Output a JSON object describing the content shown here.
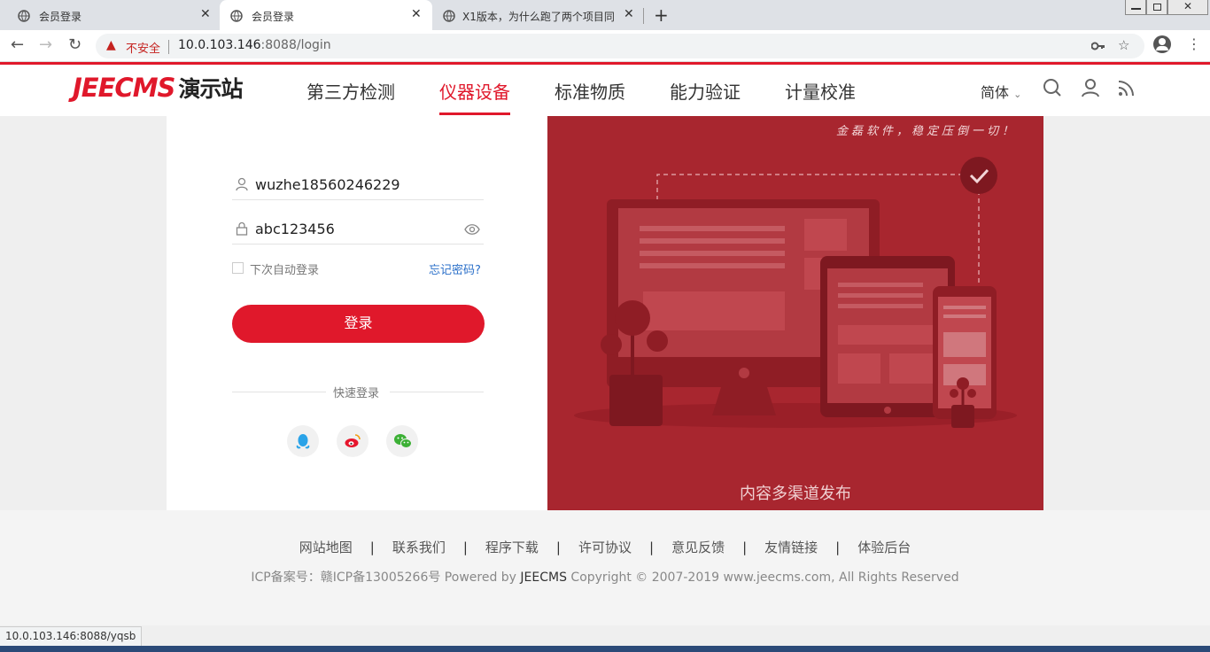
{
  "browser": {
    "tabs": [
      {
        "title": "会员登录",
        "active": false
      },
      {
        "title": "会员登录",
        "active": true
      },
      {
        "title": "X1版本，为什么跑了两个项目同…",
        "active": false
      }
    ],
    "insecure_label": "不安全",
    "url_host": "10.0.103.146",
    "url_rest": ":8088/login",
    "status_url": "10.0.103.146:8088/yqsb"
  },
  "header": {
    "logo_text": "JEECMS",
    "logo_cn": "演示站",
    "nav": [
      "第三方检测",
      "仪器设备",
      "标准物质",
      "能力验证",
      "计量校准"
    ],
    "active_nav": 1,
    "lang": "简体"
  },
  "login": {
    "username": "wuzhe18560246229",
    "password": "abc123456",
    "remember_label": "下次自动登录",
    "forgot_label": "忘记密码?",
    "submit_label": "登录",
    "quick_login_label": "快速登录"
  },
  "promo": {
    "slogan": "金磊软件，稳定压倒一切！",
    "caption": "内容多渠道发布"
  },
  "footer": {
    "links": [
      "网站地图",
      "联系我们",
      "程序下载",
      "许可协议",
      "意见反馈",
      "友情链接",
      "体验后台"
    ],
    "separator": "|",
    "copyright_pre": "ICP备案号：赣ICP备13005266号 Powered by ",
    "copyright_brand": "JEECMS",
    "copyright_post": " Copyright © 2007-2019 www.jeecms.com, All Rights Reserved"
  },
  "colors": {
    "brand_red": "#e0182b",
    "promo_bg": "#a8262f"
  }
}
